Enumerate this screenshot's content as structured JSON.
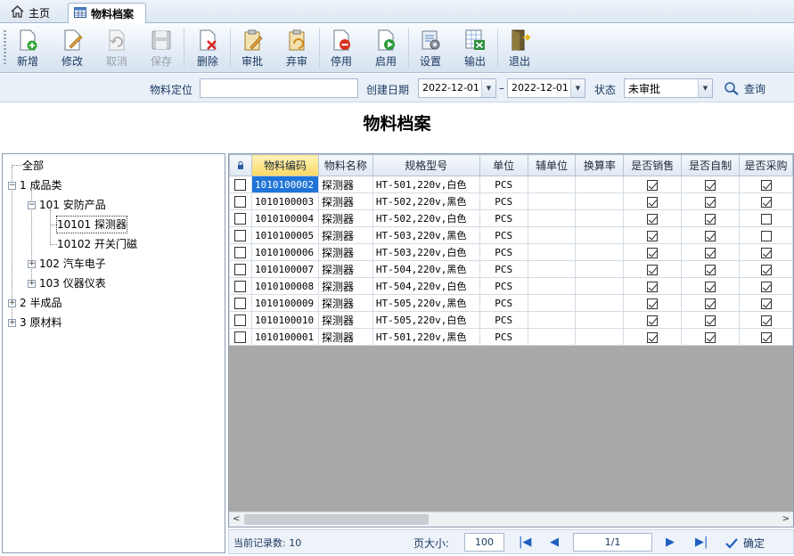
{
  "tabs": {
    "home": "主页",
    "active": "物料档案"
  },
  "toolbar": {
    "new": "新增",
    "edit": "修改",
    "cancel": "取消",
    "save": "保存",
    "delete": "删除",
    "approve": "审批",
    "unapprove": "弃审",
    "disable": "停用",
    "enable": "启用",
    "settings": "设置",
    "export": "输出",
    "exit": "退出"
  },
  "filter": {
    "locate_label": "物料定位",
    "locate_value": "",
    "date_label": "创建日期",
    "date_from": "2022-12-01",
    "date_sep": "–",
    "date_to": "2022-12-01",
    "status_label": "状态",
    "status_value": "未审批",
    "query_label": "查询"
  },
  "page_title": "物料档案",
  "tree": {
    "all": "全部",
    "n1": "1 成品类",
    "n101": "101 安防产品",
    "n10101": "10101 探测器",
    "n10102": "10102 开关门磁",
    "n102": "102 汽车电子",
    "n103": "103 仪器仪表",
    "n2": "2 半成品",
    "n3": "3 原材料"
  },
  "grid": {
    "columns": [
      "物料编码",
      "物料名称",
      "规格型号",
      "单位",
      "辅单位",
      "换算率",
      "是否销售",
      "是否自制",
      "是否采购"
    ],
    "rows": [
      {
        "code": "1010100002",
        "name": "探测器",
        "spec": "HT-501,220v,白色",
        "unit": "PCS",
        "sale": true,
        "self": true,
        "buy": true
      },
      {
        "code": "1010100003",
        "name": "探测器",
        "spec": "HT-502,220v,黑色",
        "unit": "PCS",
        "sale": true,
        "self": true,
        "buy": true
      },
      {
        "code": "1010100004",
        "name": "探测器",
        "spec": "HT-502,220v,白色",
        "unit": "PCS",
        "sale": true,
        "self": true,
        "buy": false
      },
      {
        "code": "1010100005",
        "name": "探测器",
        "spec": "HT-503,220v,黑色",
        "unit": "PCS",
        "sale": true,
        "self": true,
        "buy": false
      },
      {
        "code": "1010100006",
        "name": "探测器",
        "spec": "HT-503,220v,白色",
        "unit": "PCS",
        "sale": true,
        "self": true,
        "buy": true
      },
      {
        "code": "1010100007",
        "name": "探测器",
        "spec": "HT-504,220v,黑色",
        "unit": "PCS",
        "sale": true,
        "self": true,
        "buy": true
      },
      {
        "code": "1010100008",
        "name": "探测器",
        "spec": "HT-504,220v,白色",
        "unit": "PCS",
        "sale": true,
        "self": true,
        "buy": true
      },
      {
        "code": "1010100009",
        "name": "探测器",
        "spec": "HT-505,220v,黑色",
        "unit": "PCS",
        "sale": true,
        "self": true,
        "buy": true
      },
      {
        "code": "1010100010",
        "name": "探测器",
        "spec": "HT-505,220v,白色",
        "unit": "PCS",
        "sale": true,
        "self": true,
        "buy": true
      },
      {
        "code": "1010100001",
        "name": "探测器",
        "spec": "HT-501,220v,黑色",
        "unit": "PCS",
        "sale": true,
        "self": true,
        "buy": true
      }
    ]
  },
  "status": {
    "record_count": "当前记录数: 10",
    "page_size_label": "页大小:",
    "page_size": "100",
    "page_info": "1/1",
    "confirm": "确定"
  },
  "colors": {
    "accent": "#1e74d8",
    "header_sort": "#f9d863"
  }
}
